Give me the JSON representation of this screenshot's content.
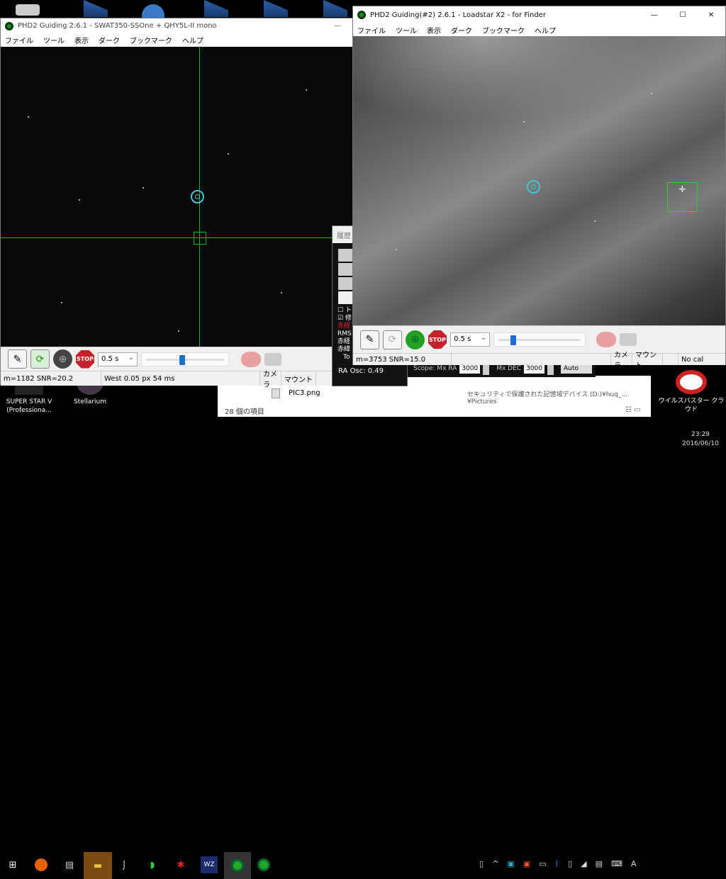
{
  "left_window": {
    "title": "PHD2 Guiding 2.6.1 - SWAT350-SSOne + QHY5L-II mono",
    "minimize": "—",
    "menu": [
      "ファイル",
      "ツール",
      "表示",
      "ダーク",
      "ブックマーク",
      "ヘルプ"
    ],
    "exposure": "0.5 s",
    "exposure_slider": 0.45,
    "status": {
      "star": "m=1182 SNR=20.2",
      "guide": "West  0.05 px  54 ms",
      "camera": "カメラ",
      "mount": "マウント"
    }
  },
  "right_window": {
    "title": "PHD2 Guiding(#2) 2.6.1 - Loadstar X2 - for Finder",
    "minimize": "—",
    "maximize": "☐",
    "close": "✕",
    "menu": [
      "ファイル",
      "ツール",
      "表示",
      "ダーク",
      "ブックマーク",
      "ヘルプ"
    ],
    "exposure": "0.5 s",
    "exposure_slider": 0.15,
    "status": {
      "star": "m=3753 SNR=15.0",
      "camera": "カメラ",
      "mount": "マウント",
      "cal": "No cal"
    }
  },
  "graph_window": {
    "tab": "履歴",
    "labels": [
      "ト",
      "修",
      "赤経",
      "RMS",
      "赤経",
      "赤緯",
      "To"
    ],
    "ra_osc": "RA Osc: 0.49",
    "scope_label": "Scope: Mx RA",
    "mx_ra": "3000",
    "mx_dec_label": "Mx DEC",
    "mx_dec": "3000",
    "mode": "Auto"
  },
  "explorer": {
    "file": "PIC3.png",
    "count": "28 個の項目",
    "path": "セキュリティで保護された記憶域デバイス (D:)¥huq_...¥Pictures"
  },
  "desktop_icons": [
    {
      "label": "SUPER STAR V (Professiona..."
    },
    {
      "label": "Stellarium"
    },
    {
      "label": "ウイルスバスター クラウド"
    }
  ],
  "taskbar": {
    "time": "23:29",
    "date": "2016/06/10",
    "ime": "A"
  }
}
